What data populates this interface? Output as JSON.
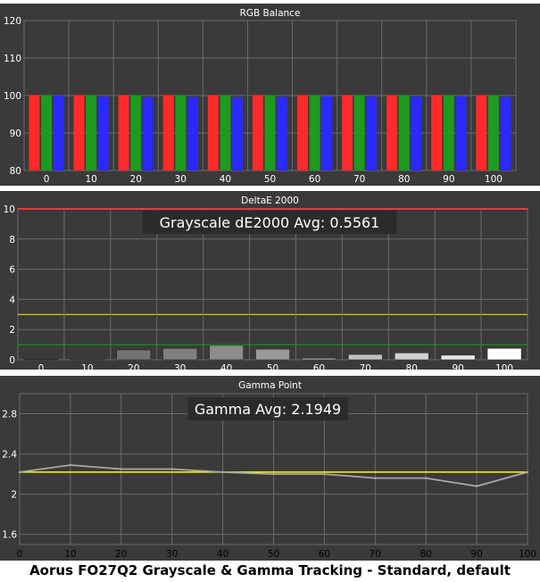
{
  "caption": "Aorus FO27Q2 Grayscale & Gamma Tracking - Standard, default",
  "colors": {
    "panel_bg": "#3a3a3a",
    "grid": "#6b6b6b",
    "text": "#ffffff",
    "red_bar": "#ff2a2a",
    "green_bar": "#1e9a1e",
    "blue_bar": "#2a2aff",
    "limit_red": "#ff3b3b",
    "limit_yellow": "#e0e000",
    "limit_green": "#0c9a0c",
    "gamma_line": "#a8a8a8",
    "gamma_target": "#ffff00"
  },
  "chart_data": [
    {
      "type": "bar",
      "title": "RGB Balance",
      "categories": [
        "0",
        "10",
        "20",
        "30",
        "40",
        "50",
        "60",
        "70",
        "80",
        "90",
        "100"
      ],
      "yticks": [
        80,
        90,
        100,
        110,
        120
      ],
      "ylim": [
        80,
        120
      ],
      "grid": true,
      "series": [
        {
          "color": "red",
          "values": [
            100.1,
            100.1,
            100.1,
            100.1,
            100.1,
            100.1,
            100.1,
            100.1,
            100.1,
            100.1,
            100.1
          ]
        },
        {
          "color": "green",
          "values": [
            100.1,
            100.1,
            100.1,
            100.1,
            100.1,
            100.1,
            100.1,
            100.1,
            100.1,
            100.1,
            100.1
          ]
        },
        {
          "color": "blue",
          "values": [
            100.0,
            99.7,
            99.5,
            99.6,
            99.5,
            99.6,
            99.8,
            99.7,
            99.7,
            99.8,
            99.6
          ]
        }
      ]
    },
    {
      "type": "bar",
      "title": "DeltaE 2000",
      "annotation": "Grayscale dE2000 Avg: 0.5561",
      "categories": [
        "0",
        "10",
        "20",
        "30",
        "40",
        "50",
        "60",
        "70",
        "80",
        "90",
        "100"
      ],
      "values": [
        0.02,
        0.05,
        0.65,
        0.75,
        0.95,
        0.7,
        0.1,
        0.35,
        0.45,
        0.3,
        0.75
      ],
      "bar_grays": [
        0.35,
        0.42,
        0.45,
        0.5,
        0.55,
        0.6,
        0.68,
        0.75,
        0.82,
        0.9,
        1.0
      ],
      "yticks": [
        0,
        2,
        4,
        6,
        8,
        10
      ],
      "ylim": [
        0,
        10
      ],
      "limit_lines": [
        10,
        3,
        1
      ],
      "grid": true
    },
    {
      "type": "line",
      "title": "Gamma Point",
      "annotation": "Gamma Avg: 2.1949",
      "x": [
        0,
        10,
        20,
        30,
        40,
        50,
        60,
        70,
        80,
        90,
        100
      ],
      "values": [
        2.22,
        2.29,
        2.25,
        2.25,
        2.22,
        2.2,
        2.2,
        2.16,
        2.16,
        2.08,
        2.22
      ],
      "target": 2.22,
      "xticks": [
        "0",
        "10",
        "20",
        "30",
        "40",
        "50",
        "60",
        "70",
        "80",
        "90",
        "100"
      ],
      "yticks": [
        "1.6",
        "2",
        "2.4",
        "2.8"
      ],
      "ylim": [
        1.5,
        3.0
      ],
      "xlim": [
        0,
        100
      ],
      "grid": true
    }
  ]
}
